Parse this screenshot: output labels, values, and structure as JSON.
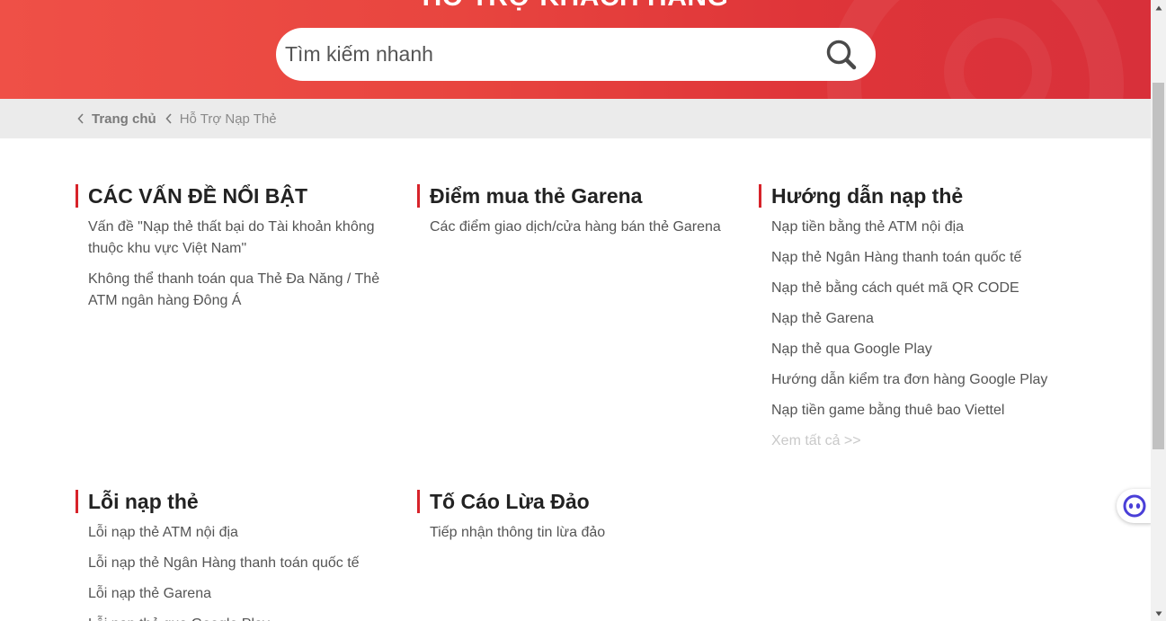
{
  "hero": {
    "title": "HỖ TRỢ KHÁCH HÀNG",
    "search_placeholder": "Tìm kiếm nhanh"
  },
  "breadcrumb": {
    "home": "Trang chủ",
    "current": "Hỗ Trợ Nạp Thẻ"
  },
  "sections": {
    "featured": {
      "title": "CÁC VẤN ĐỀ NỔI BẬT",
      "items": [
        "Vấn đề \"Nạp thẻ thất bại do Tài khoản không thuộc khu vực Việt Nam\"",
        "Không thể thanh toán qua Thẻ Đa Năng / Thẻ ATM ngân hàng Đông Á"
      ]
    },
    "buy_points": {
      "title": "Điểm mua thẻ Garena",
      "items": [
        "Các điểm giao dịch/cửa hàng bán thẻ Garena"
      ]
    },
    "guide": {
      "title": "Hướng dẫn nạp thẻ",
      "items": [
        "Nạp tiền bằng thẻ ATM nội địa",
        "Nạp thẻ Ngân Hàng thanh toán quốc tế",
        "Nạp thẻ bằng cách quét mã QR CODE",
        "Nạp thẻ Garena",
        "Nạp thẻ qua Google Play",
        "Hướng dẫn kiểm tra đơn hàng Google Play",
        "Nạp tiền game bằng thuê bao Viettel"
      ],
      "see_all": "Xem tất cả >>"
    },
    "errors": {
      "title": "Lỗi nạp thẻ",
      "items": [
        "Lỗi nạp thẻ ATM nội địa",
        "Lỗi nạp thẻ Ngân Hàng thanh toán quốc tế",
        "Lỗi nạp thẻ Garena",
        "Lỗi nạp thẻ qua Google Play"
      ]
    },
    "fraud": {
      "title": "Tố Cáo Lừa Đảo",
      "items": [
        "Tiếp nhận thông tin lừa đảo"
      ]
    }
  },
  "colors": {
    "brand_red": "#d7232a",
    "hero_red": "#e8453f",
    "breadcrumb_bg": "#ebebeb"
  }
}
